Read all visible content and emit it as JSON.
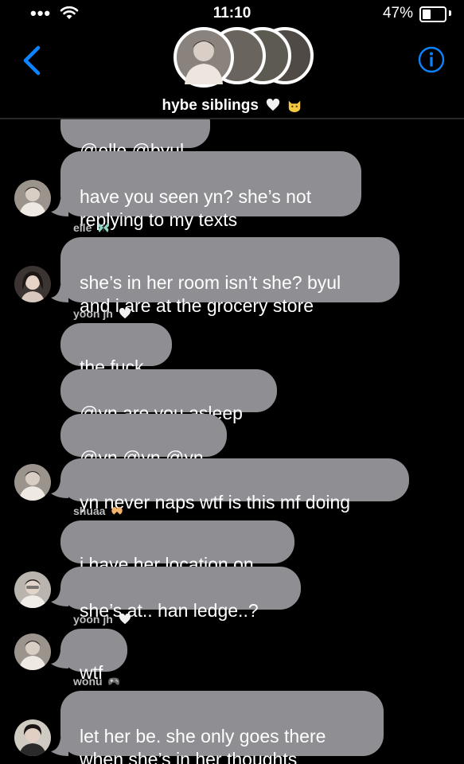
{
  "status_bar": {
    "dots": "•••",
    "time": "11:10",
    "battery_pct": "47%",
    "battery_level": 0.47
  },
  "header": {
    "title": "hybe siblings",
    "title_emojis": [
      "white-heart-icon",
      "cat-icon"
    ]
  },
  "messages": [
    {
      "text": "@elle @byul",
      "avatar": null
    },
    {
      "text": "have you seen yn? she’s not\nreplying to my texts",
      "avatar": "yoon-jh"
    },
    {
      "sender": "elle",
      "sender_emoji": "butterfly-icon"
    },
    {
      "text": "she’s in her room isn’t she? byul\nand i are at the grocery store",
      "avatar": "elle"
    },
    {
      "sender": "yoon jh",
      "sender_emoji": "white-heart-icon"
    },
    {
      "text": "the fuck",
      "avatar": null
    },
    {
      "text": "@yn are you asleep",
      "avatar": null
    },
    {
      "text": "@yn @yn @yn",
      "avatar": null
    },
    {
      "text": "yn never naps wtf is this mf doing",
      "avatar": "yoon-jh"
    },
    {
      "sender": "shuaa",
      "sender_emoji": "heart-hands-icon"
    },
    {
      "text": "i have her location on",
      "avatar": null
    },
    {
      "text": "she’s at.. han ledge..?",
      "avatar": "shuaa"
    },
    {
      "sender": "yoon jh",
      "sender_emoji": "white-heart-icon"
    },
    {
      "text": "wtf",
      "avatar": "yoon-jh"
    },
    {
      "sender": "wonu",
      "sender_emoji": "game-controller-icon"
    },
    {
      "text": "let her be. she only goes there\nwhen she’s in her thoughts",
      "avatar": "wonu"
    }
  ],
  "colors": {
    "bubble": "#8e8e93",
    "accent": "#0a84ff",
    "background": "#000000"
  }
}
